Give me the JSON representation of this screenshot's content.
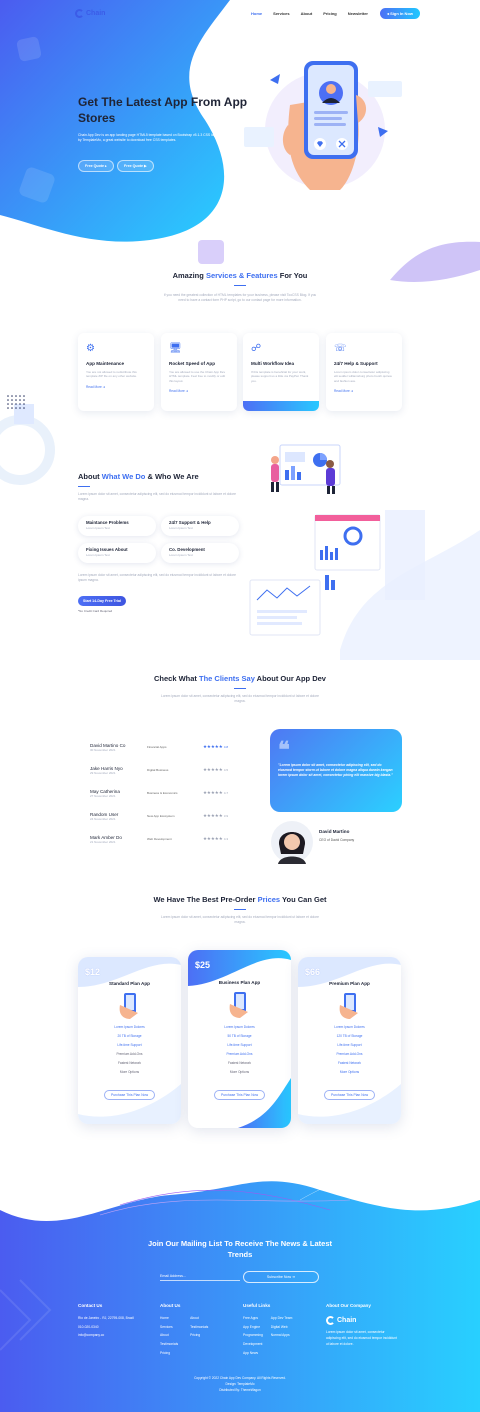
{
  "brand": {
    "name": "Chain"
  },
  "nav": {
    "items": [
      "Home",
      "Services",
      "About",
      "Pricing",
      "Newsletter"
    ],
    "sign_in": "Sign In Now"
  },
  "hero": {
    "title": "Get The Latest App From App Stores",
    "text": "Chain App Dev is an app landing page HTML5 template based on Bootstrap v5.1.3 CSS layout provided by TemplateMo, a great website to download free CSS templates.",
    "btn1": "Free Quote",
    "btn2": "Free Quote"
  },
  "services": {
    "title_a": "Amazing ",
    "title_b": "Services & Features",
    "title_c": " For You",
    "subtitle": "If you need the greatest collection of HTML templates for your business, please visit TooCSS Blog. If you need to have a contact form PHP script, go to our contact page for more information.",
    "cards": [
      {
        "title": "App Maintenance",
        "text": "You are not allowed to redistribute this template ZIP file on any other website.",
        "more": "Read More"
      },
      {
        "title": "Rocket Speed of App",
        "text": "You are allowed to use the Chain App Dev HTML template. Feel free to modify or edit this layout.",
        "more": "Read More"
      },
      {
        "title": "Multi Workflow Idea",
        "text": "If this template is beneficial for your work, please support us a little via PayPal. Thank you.",
        "more": ""
      },
      {
        "title": "24/7 Help & Support",
        "text": "Lorem ipsum dolor consectetur adipiscing elit sedder williamsburg photo booth quinoa and fashion axe.",
        "more": "Read More"
      }
    ]
  },
  "about": {
    "title_a": "About ",
    "title_b": "What We Do",
    "title_c": " & Who We Are",
    "text1": "Lorem ipsum dolor sit amet, consectetur adipiscing elit, sed do eiusmod tempor incididunt ut labore et dolore magna.",
    "chips": [
      {
        "title": "Maintance Problems",
        "sub": "Lorem Ipsum Text"
      },
      {
        "title": "24/7 Support & Help",
        "sub": "Lorem Ipsum Text"
      },
      {
        "title": "Fixing Issues About",
        "sub": "Lorem Ipsum Text"
      },
      {
        "title": "Co. Development",
        "sub": "Lorem Ipsum Text"
      }
    ],
    "text2": "Lorem ipsum dolor sit amet, consectetur adipiscing elit, sed do eiusmod tempor incididunt ut labore et dolore ipsum magna.",
    "trial": "Start 14-Day Free Trial",
    "no_card": "*No Credit Card Required"
  },
  "clients": {
    "title_a": "Check What ",
    "title_b": "The Clients Say",
    "title_c": " About Our App Dev",
    "subtitle": "Lorem ipsum dolor sit amet, consectetur adipiscing elit, sed do eiusmod tempor incididunt ut labore et dolore magna.",
    "rows": [
      {
        "name": "David Martino Co",
        "date": "30 November 2021",
        "category": "Financial Apps",
        "stars": "★★★★★",
        "rating": "4.8"
      },
      {
        "name": "Jake Harris Nyo",
        "date": "29 November 2021",
        "category": "Digital Business",
        "stars": "★★★★★",
        "rating": "4.5"
      },
      {
        "name": "May Catherina",
        "date": "27 November 2021",
        "category": "Business & Economics",
        "stars": "★★★★★",
        "rating": "4.7"
      },
      {
        "name": "Random User",
        "date": "24 November 2021",
        "category": "New App Ecosystem",
        "stars": "★★★★★",
        "rating": "3.9"
      },
      {
        "name": "Mark Amber Do",
        "date": "21 November 2021",
        "category": "Web Development",
        "stars": "★★★★★",
        "rating": "4.3"
      }
    ],
    "quote": "\"Lorem ipsum dolor sit amet, consectetur adipiscing elit, sed do eiusmod tempor storm ut labore et dolore magna aliqua darwin kengan lorem ipsum dolor sit amet, consectetur picing elit massive big blasta.\"",
    "person_name": "David Martino",
    "person_role": "CEO of David Company"
  },
  "pricing": {
    "title_a": "We Have The Best Pre-Order ",
    "title_b": "Prices",
    "title_c": " You Can Get",
    "subtitle": "Lorem ipsum dolor sit amet, consectetur adipiscing elit, sed do eiusmod tempor incididunt ut labore et dolore magna.",
    "plans": [
      {
        "price": "$12",
        "name": "Standard Plan App",
        "features": [
          "Lorem Ipsum Dolores",
          "20 TB of Storage",
          "Life-time Support",
          "Premium Add-Ons",
          "Fastest Network",
          "More Options"
        ],
        "button": "Purchase This Plan Now"
      },
      {
        "price": "$25",
        "name": "Business Plan App",
        "features": [
          "Lorem Ipsum Dolores",
          "50 TB of Storage",
          "Life-time Support",
          "Premium Add-Ons",
          "Fastest Network",
          "More Options"
        ],
        "button": "Purchase This Plan Now"
      },
      {
        "price": "$66",
        "name": "Premium Plan App",
        "features": [
          "Lorem Ipsum Dolores",
          "120 TB of Storage",
          "Life-time Support",
          "Premium Add-Ons",
          "Fastest Network",
          "More Options"
        ],
        "button": "Purchase This Plan Now"
      }
    ]
  },
  "newsletter": {
    "title": "Join Our Mailing List To Receive The News & Latest Trends",
    "email_placeholder": "Email Address...",
    "button": "Subscribe Now"
  },
  "footer": {
    "contact": {
      "title": "Contact Us",
      "lines": [
        "Rio de Janeiro - RJ, 22795-008, Brazil",
        "010-020-0340",
        "info@company.co"
      ]
    },
    "about": {
      "title": "About Us",
      "col1": [
        "Home",
        "Services",
        "About",
        "Testimonials",
        "Pricing"
      ],
      "col2": [
        "About",
        "Testimonials",
        "Pricing"
      ]
    },
    "links": {
      "title": "Useful Links",
      "col1": [
        "Free Apps",
        "App Engine",
        "Programming",
        "Development",
        "App News"
      ],
      "col2": [
        "App Dev Team",
        "Digital Web",
        "Normal Apps"
      ]
    },
    "company": {
      "title": "About Our Company",
      "text": "Lorem ipsum dolor sit amet, consectetur adipiscing elit, sed do eiusmod tempor incididunt ut labore et dolore."
    },
    "copyright": "Copyright © 2022 Chain App Dev Company. All Rights Reserved.",
    "design": "Design: TemplateMo",
    "distributed": "Distributed By: ThemeWagon"
  }
}
